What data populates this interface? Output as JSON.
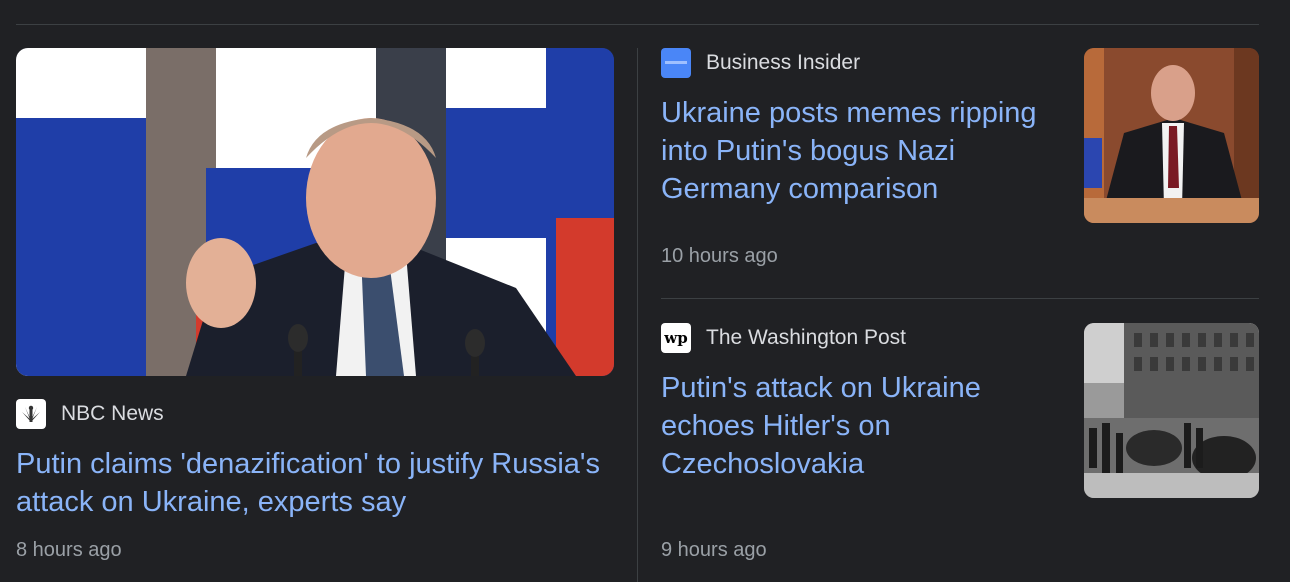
{
  "articles": [
    {
      "source": "NBC News",
      "source_icon": "nbc-peacock-icon",
      "headline": "Putin claims 'denazification' to justify Russia's attack on Ukraine, experts say",
      "time": "8 hours ago"
    },
    {
      "source": "Business Insider",
      "source_icon": "business-insider-icon",
      "headline": "Ukraine posts memes ripping into Putin's bogus Nazi Germany comparison",
      "time": "10 hours ago"
    },
    {
      "source": "The Washington Post",
      "source_icon": "washington-post-icon",
      "logo_text": "wp",
      "headline": "Putin's attack on Ukraine echoes Hitler's on Czechoslovakia",
      "time": "9 hours ago"
    }
  ],
  "colors": {
    "background": "#202124",
    "headline": "#8ab4f8",
    "meta": "#9aa0a6",
    "divider": "#3c4043"
  }
}
